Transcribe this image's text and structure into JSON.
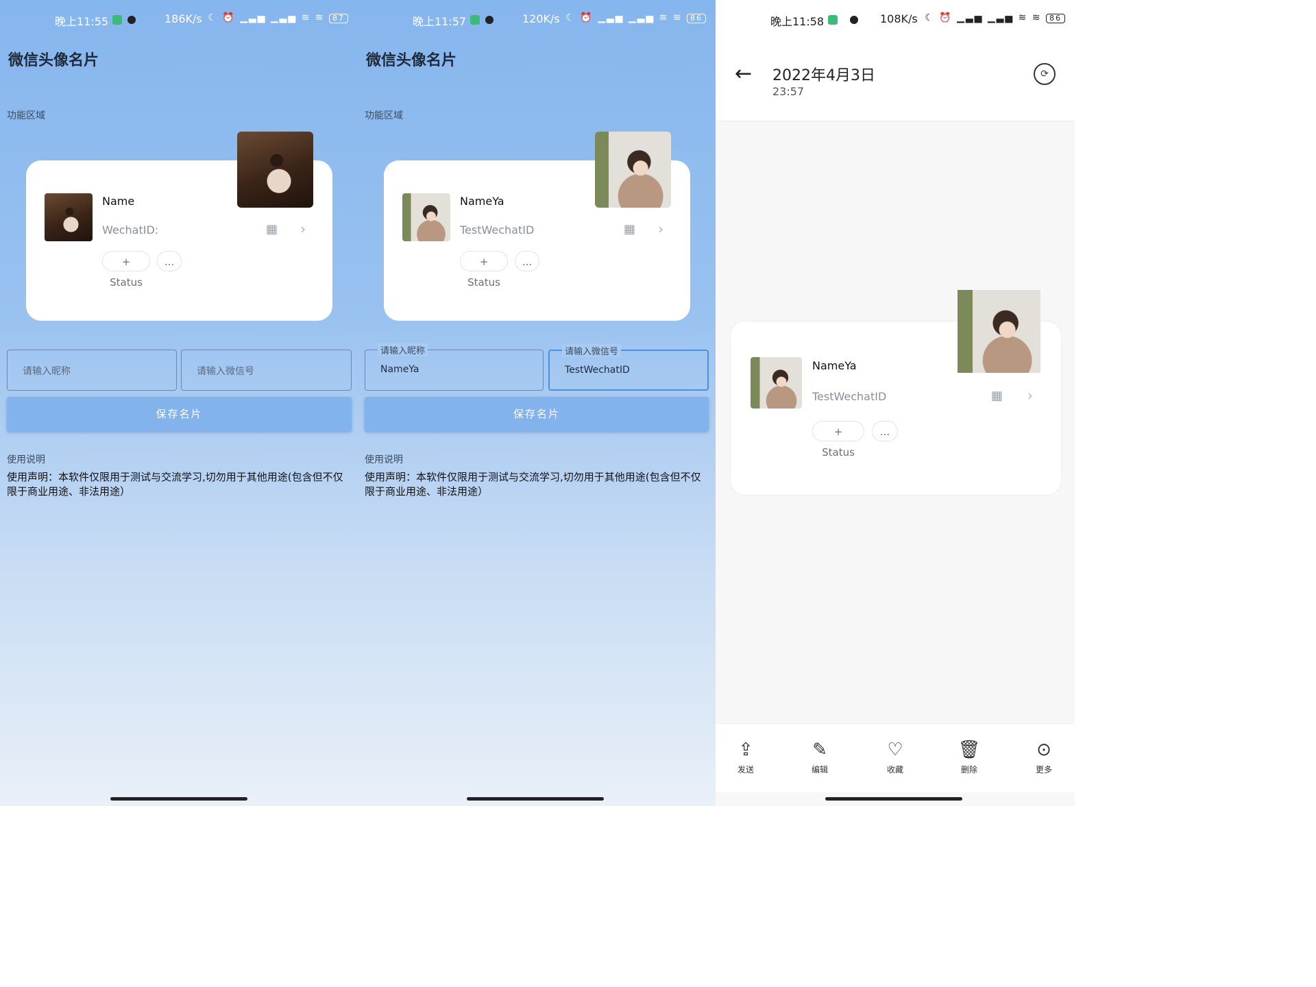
{
  "panel1": {
    "status": {
      "time": "晚上11:55",
      "speed": "186K/s",
      "icons": "☾ ⏰ ▁▃▅ ▁▃▅ ≋ ≋",
      "battery": "87"
    },
    "title": "微信头像名片",
    "section": "功能区域",
    "card": {
      "name": "Name",
      "wechat_id": "WechatID:",
      "status_chip": "+ Status",
      "more_chip": "..."
    },
    "inputs": {
      "nickname_placeholder": "请输入昵称",
      "wechat_placeholder": "请输入微信号"
    },
    "save_label": "保存名片",
    "usage_title": "使用说明",
    "usage_text": "使用声明：本软件仅限用于测试与交流学习,切勿用于其他用途(包含但不仅限于商业用途、非法用途）"
  },
  "panel2": {
    "status": {
      "time": "晚上11:57",
      "speed": "120K/s",
      "icons": "☾ ⏰ ▁▃▅ ▁▃▅ ≋ ≋",
      "battery": "86"
    },
    "title": "微信头像名片",
    "section": "功能区域",
    "card": {
      "name": "NameYa",
      "wechat_id": "TestWechatID",
      "status_chip": "+ Status",
      "more_chip": "..."
    },
    "inputs": {
      "nickname_label": "请输入昵称",
      "nickname_value": "NameYa",
      "wechat_label": "请输入微信号",
      "wechat_value": "TestWechatID"
    },
    "save_label": "保存名片",
    "usage_title": "使用说明",
    "usage_text": "使用声明：本软件仅限用于测试与交流学习,切勿用于其他用途(包含但不仅限于商业用途、非法用途）"
  },
  "panel3": {
    "status": {
      "time": "晚上11:58",
      "speed": "108K/s",
      "icons": "☾ ⏰ ▁▃▅ ▁▃▅ ≋ ≋",
      "battery": "86"
    },
    "date": "2022年4月3日",
    "clock": "23:57",
    "card": {
      "name": "NameYa",
      "wechat_id": "TestWechatID",
      "status_chip": "+ Status",
      "more_chip": "..."
    },
    "actions": [
      {
        "icon": "share-icon",
        "label": "发送"
      },
      {
        "icon": "edit-icon",
        "label": "编辑"
      },
      {
        "icon": "heart-icon",
        "label": "收藏"
      },
      {
        "icon": "trash-icon",
        "label": "删除"
      },
      {
        "icon": "more-icon",
        "label": "更多"
      }
    ]
  }
}
